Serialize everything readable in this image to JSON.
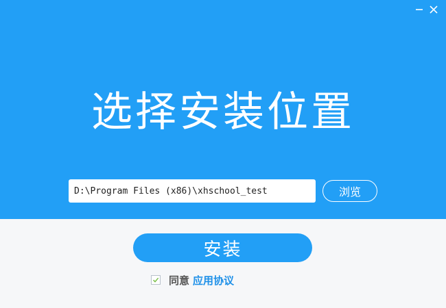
{
  "window": {
    "minimize_icon": "minimize-icon",
    "close_icon": "close-icon"
  },
  "header": {
    "title": "选择安装位置"
  },
  "path": {
    "value": "D:\\Program Files (x86)\\xhschool_test"
  },
  "browse": {
    "label": "浏览"
  },
  "install": {
    "label": "安装"
  },
  "agreement": {
    "checked": true,
    "check_icon": "check-icon",
    "text": "同意",
    "link": "应用协议"
  },
  "colors": {
    "primary": "#229ff6",
    "link": "#1e90e8",
    "footer_bg": "#f6f7f9",
    "check": "#7cc04b"
  }
}
